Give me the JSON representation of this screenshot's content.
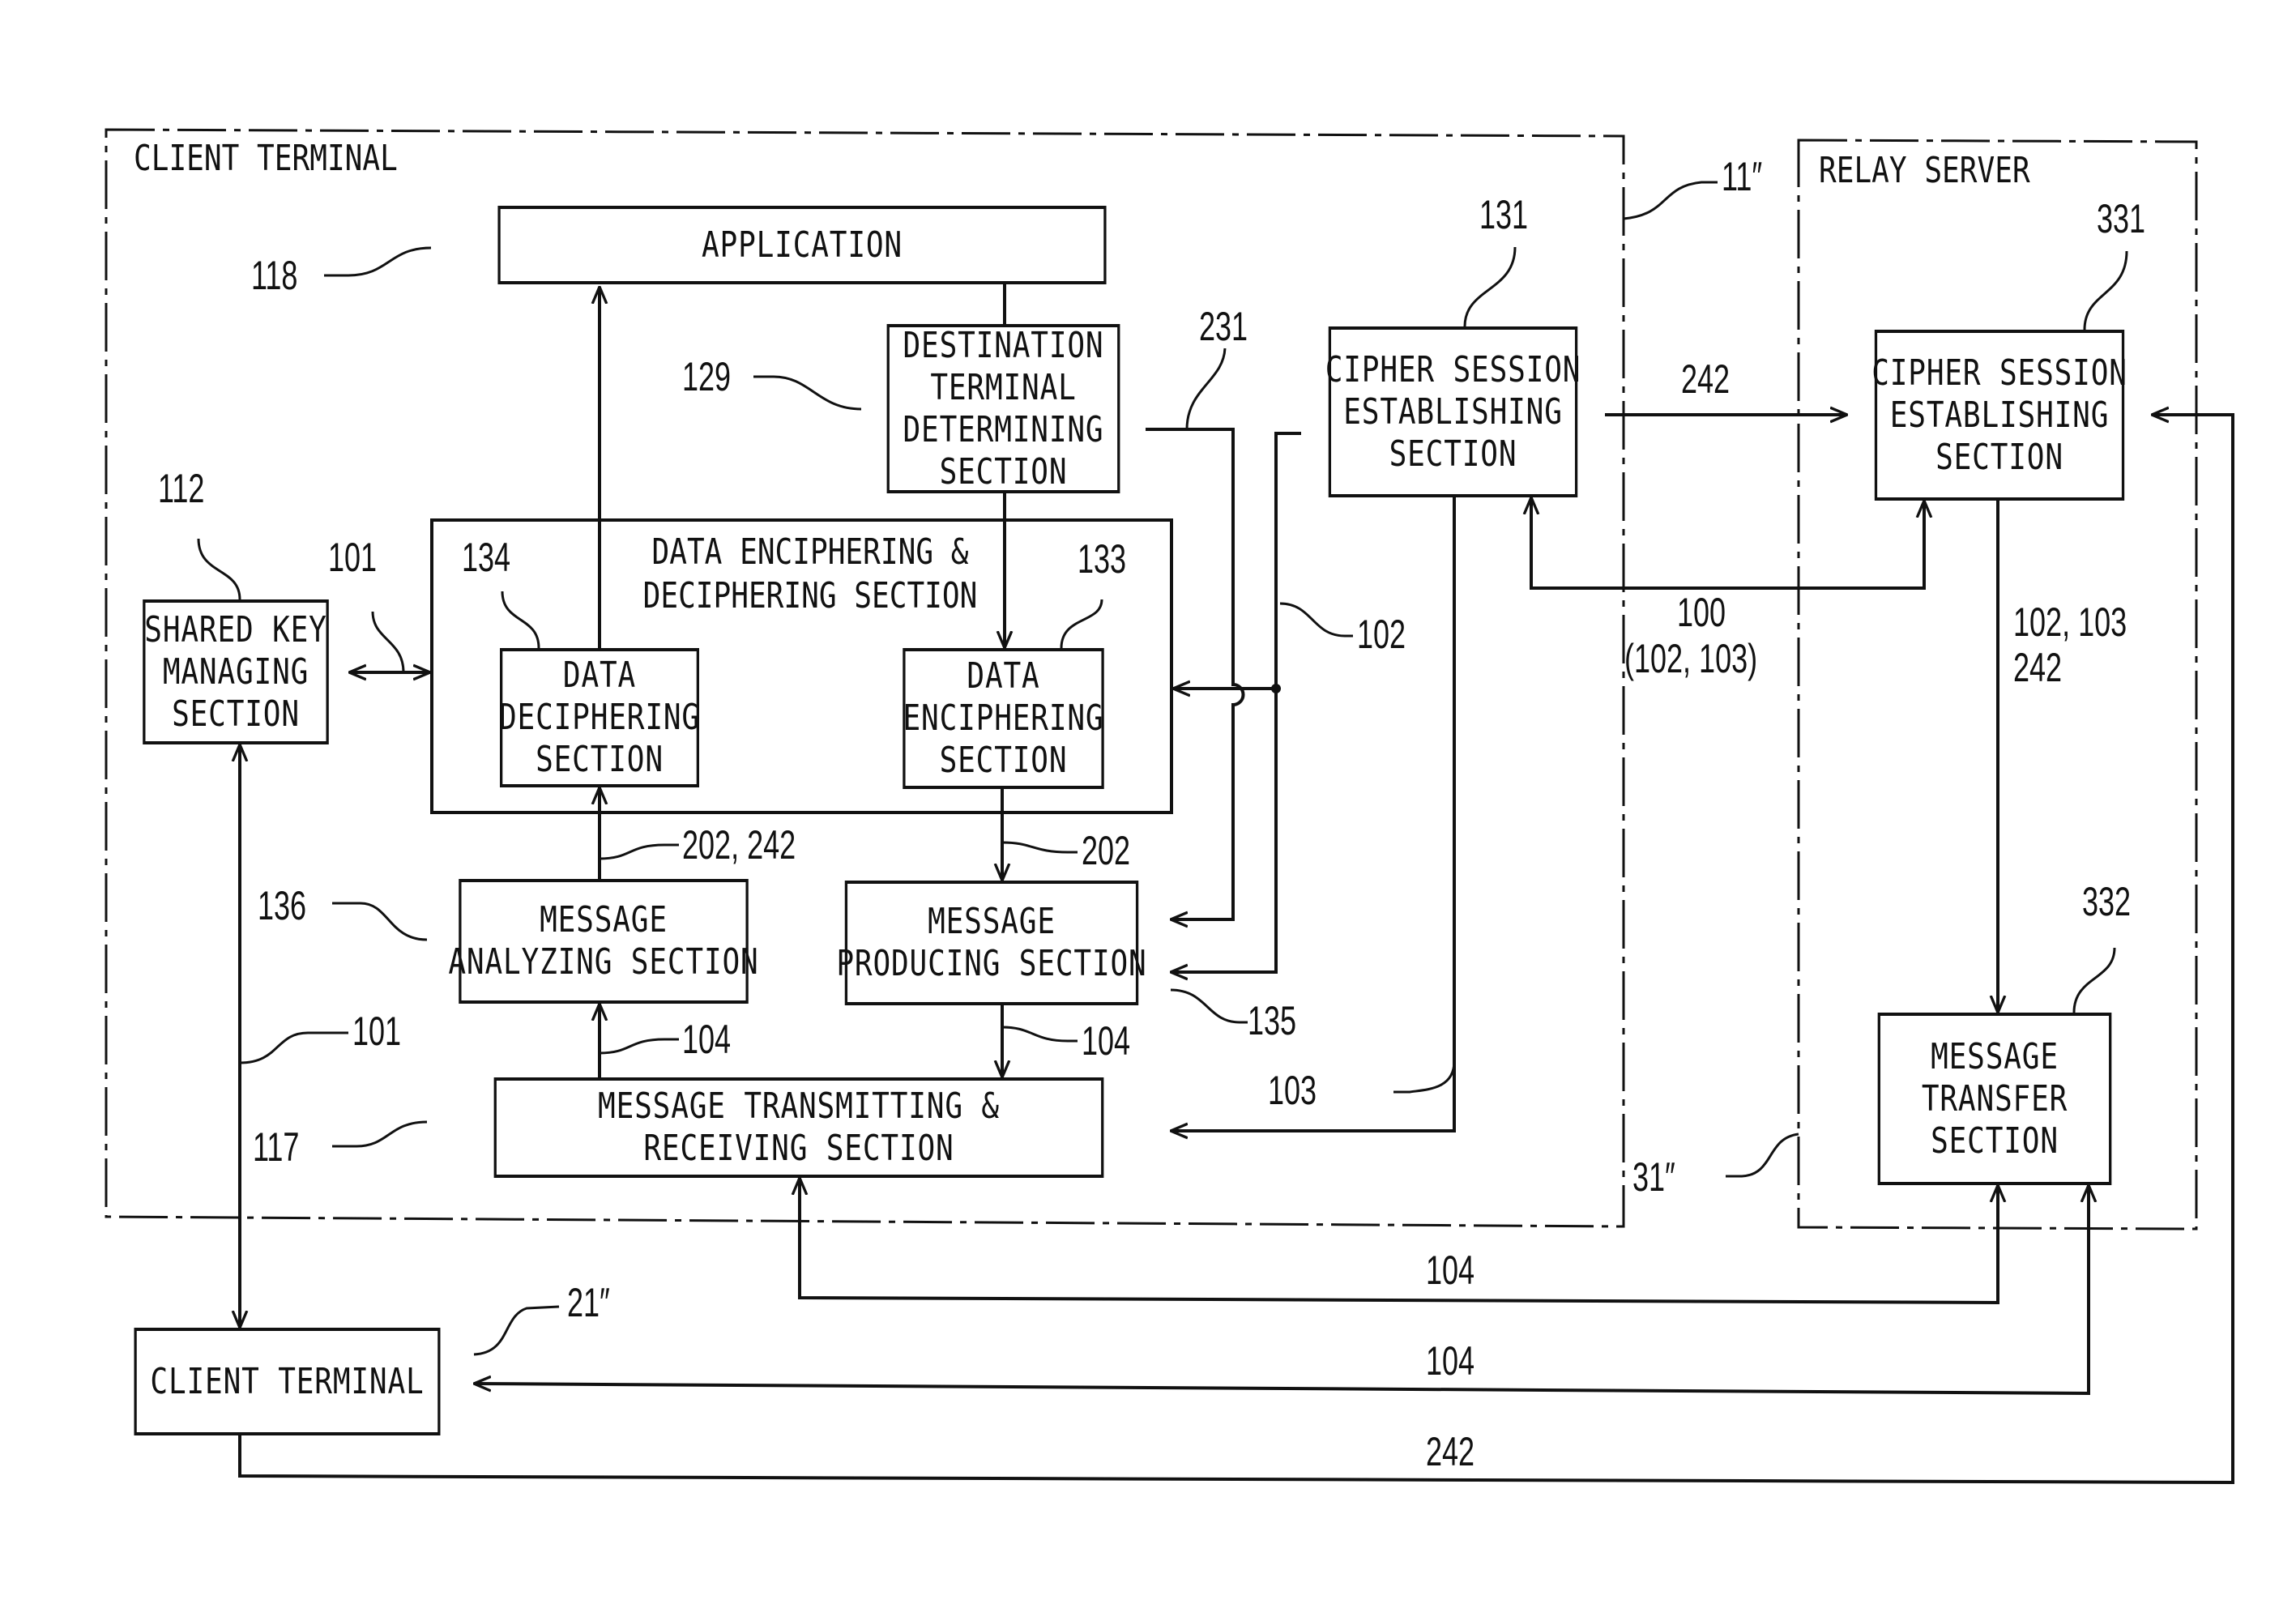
{
  "regions": {
    "client_terminal": {
      "title": "CLIENT TERMINAL",
      "ref": "11″"
    },
    "relay_server": {
      "title": "RELAY SERVER",
      "ref": "31″"
    }
  },
  "blocks": {
    "application": {
      "lines": [
        "APPLICATION"
      ],
      "ref": "118"
    },
    "destination": {
      "lines": [
        "DESTINATION",
        "TERMINAL",
        "DETERMINING",
        "SECTION"
      ],
      "ref": "129"
    },
    "enc_dec": {
      "lines": [
        "DATA ENCIPHERING &",
        "DECIPHERING SECTION"
      ],
      "ref": "231"
    },
    "deciphering": {
      "lines": [
        "DATA",
        "DECIPHERING",
        "SECTION"
      ],
      "ref": "134"
    },
    "enciphering": {
      "lines": [
        "DATA",
        "ENCIPHERING",
        "SECTION"
      ],
      "ref": "133"
    },
    "shared_key": {
      "lines": [
        "SHARED KEY",
        "MANAGING",
        "SECTION"
      ],
      "ref": "112"
    },
    "analyzing": {
      "lines": [
        "MESSAGE",
        "ANALYZING SECTION"
      ],
      "ref": "136"
    },
    "producing": {
      "lines": [
        "MESSAGE",
        "PRODUCING SECTION"
      ],
      "ref": "135"
    },
    "txrx": {
      "lines": [
        "MESSAGE TRANSMITTING &",
        "RECEIVING SECTION"
      ],
      "ref": "117"
    },
    "cipher_client": {
      "lines": [
        "CIPHER SESSION",
        "ESTABLISHING",
        "SECTION"
      ],
      "ref": "131"
    },
    "cipher_relay": {
      "lines": [
        "CIPHER SESSION",
        "ESTABLISHING",
        "SECTION"
      ],
      "ref": "331"
    },
    "transfer": {
      "lines": [
        "MESSAGE",
        "TRANSFER",
        "SECTION"
      ],
      "ref": "332"
    },
    "client_other": {
      "lines": [
        "CLIENT TERMINAL"
      ],
      "ref": "21″"
    }
  },
  "signals": {
    "s101a": "101",
    "s101b": "101",
    "s102": "102",
    "s103": "103",
    "s202_242": "202, 242",
    "s202": "202",
    "s104a": "104",
    "s104b": "104",
    "s242_top": "242",
    "s100": "100",
    "s100_sub": "(102, 103)",
    "s_relay_1": "102, 103",
    "s_relay_2": "242",
    "s104_bottom1": "104",
    "s104_bottom2": "104",
    "s242_bottom": "242"
  }
}
